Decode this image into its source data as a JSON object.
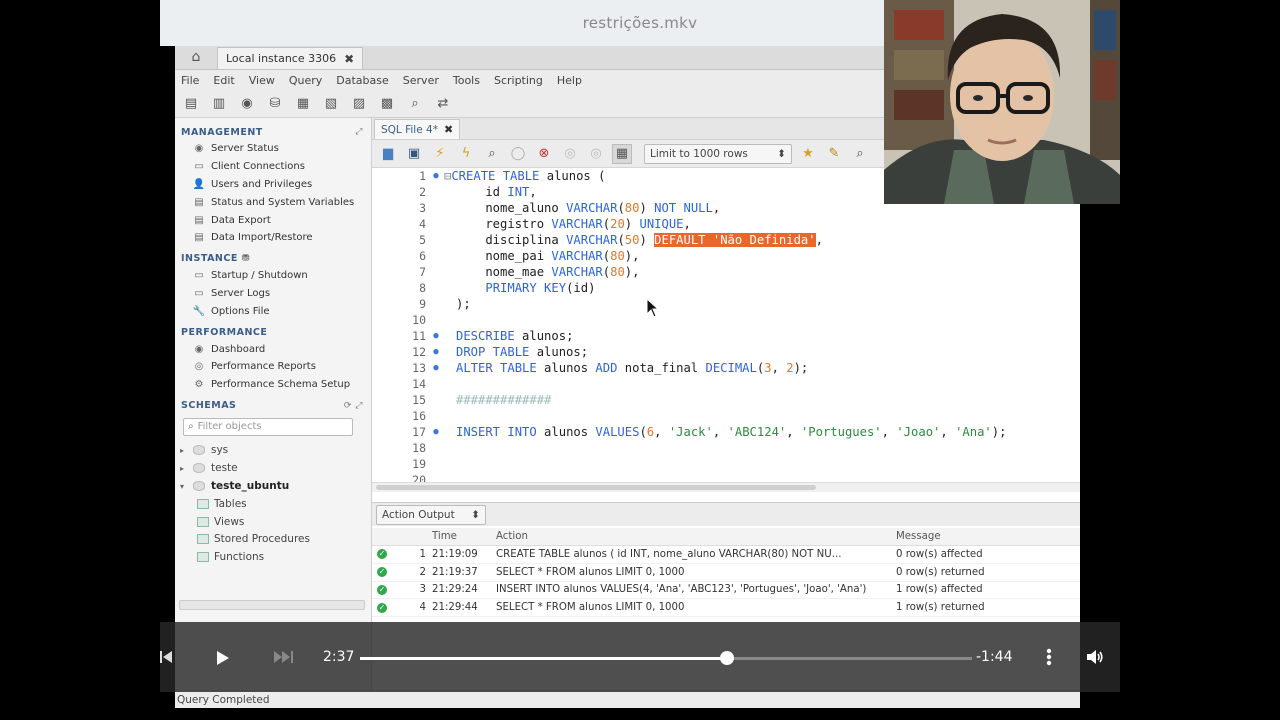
{
  "video": {
    "title": "restrições.mkv",
    "time_current": "2:37",
    "time_remaining": "-1:44",
    "progress": 0.6
  },
  "window": {
    "instance_tab": "Local instance 3306",
    "menu": [
      "File",
      "Edit",
      "View",
      "Query",
      "Database",
      "Server",
      "Tools",
      "Scripting",
      "Help"
    ]
  },
  "sidebar": {
    "management_title": "MANAGEMENT",
    "management_items": [
      "Server Status",
      "Client Connections",
      "Users and Privileges",
      "Status and System Variables",
      "Data Export",
      "Data Import/Restore"
    ],
    "instance_title": "INSTANCE",
    "instance_items": [
      "Startup / Shutdown",
      "Server Logs",
      "Options File"
    ],
    "performance_title": "PERFORMANCE",
    "performance_items": [
      "Dashboard",
      "Performance Reports",
      "Performance Schema Setup"
    ],
    "schemas_title": "SCHEMAS",
    "filter_placeholder": "Filter objects",
    "schemas": [
      "sys",
      "teste",
      "teste_ubuntu"
    ],
    "schema_children": [
      "Tables",
      "Views",
      "Stored Procedures",
      "Functions"
    ]
  },
  "editor": {
    "file_tab": "SQL File 4*",
    "limit": "Limit to 1000 rows",
    "line_numbers": [
      "1",
      "2",
      "3",
      "4",
      "5",
      "6",
      "7",
      "8",
      "9",
      "10",
      "11",
      "12",
      "13",
      "14",
      "15",
      "16",
      "17",
      "18",
      "19",
      "20"
    ]
  },
  "output": {
    "selector": "Action Output",
    "headers": [
      "",
      "Time",
      "Action",
      "Message"
    ],
    "rows": [
      {
        "n": "1",
        "time": "21:19:09",
        "action": "CREATE TABLE alunos (     id INT,      nome_aluno VARCHAR(80) NOT NU...",
        "message": "0 row(s) affected"
      },
      {
        "n": "2",
        "time": "21:19:37",
        "action": "SELECT * FROM alunos LIMIT 0, 1000",
        "message": "0 row(s) returned"
      },
      {
        "n": "3",
        "time": "21:29:24",
        "action": "INSERT INTO alunos VALUES(4, 'Ana', 'ABC123', 'Portugues', 'Joao', 'Ana')",
        "message": "1 row(s) affected"
      },
      {
        "n": "4",
        "time": "21:29:44",
        "action": "SELECT * FROM alunos LIMIT 0, 1000",
        "message": "1 row(s) returned"
      }
    ]
  },
  "status": "Query Completed"
}
